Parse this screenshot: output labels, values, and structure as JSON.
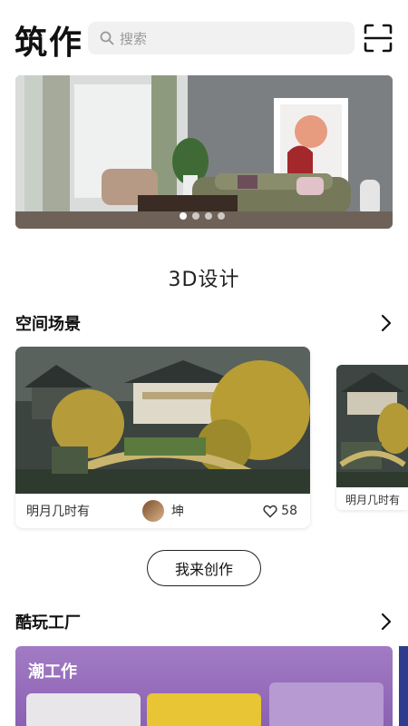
{
  "header": {
    "logo": "筑作",
    "search_placeholder": "搜索",
    "scan_icon": "scan-icon"
  },
  "banner": {
    "slide_count": 4,
    "active_slide": 1
  },
  "design_title": "3D设计",
  "section_space": {
    "title": "空间场景"
  },
  "cards": [
    {
      "name": "明月几时有",
      "author": "坤",
      "likes": "58"
    },
    {
      "name": "明月几时有"
    }
  ],
  "create_button": "我来创作",
  "section_fun": {
    "title": "酷玩工厂"
  },
  "factory": {
    "label": "潮工作"
  },
  "colors": {
    "factory_bg": "#9b73bf",
    "text": "#111111",
    "search_bg": "#f1f1f1"
  }
}
